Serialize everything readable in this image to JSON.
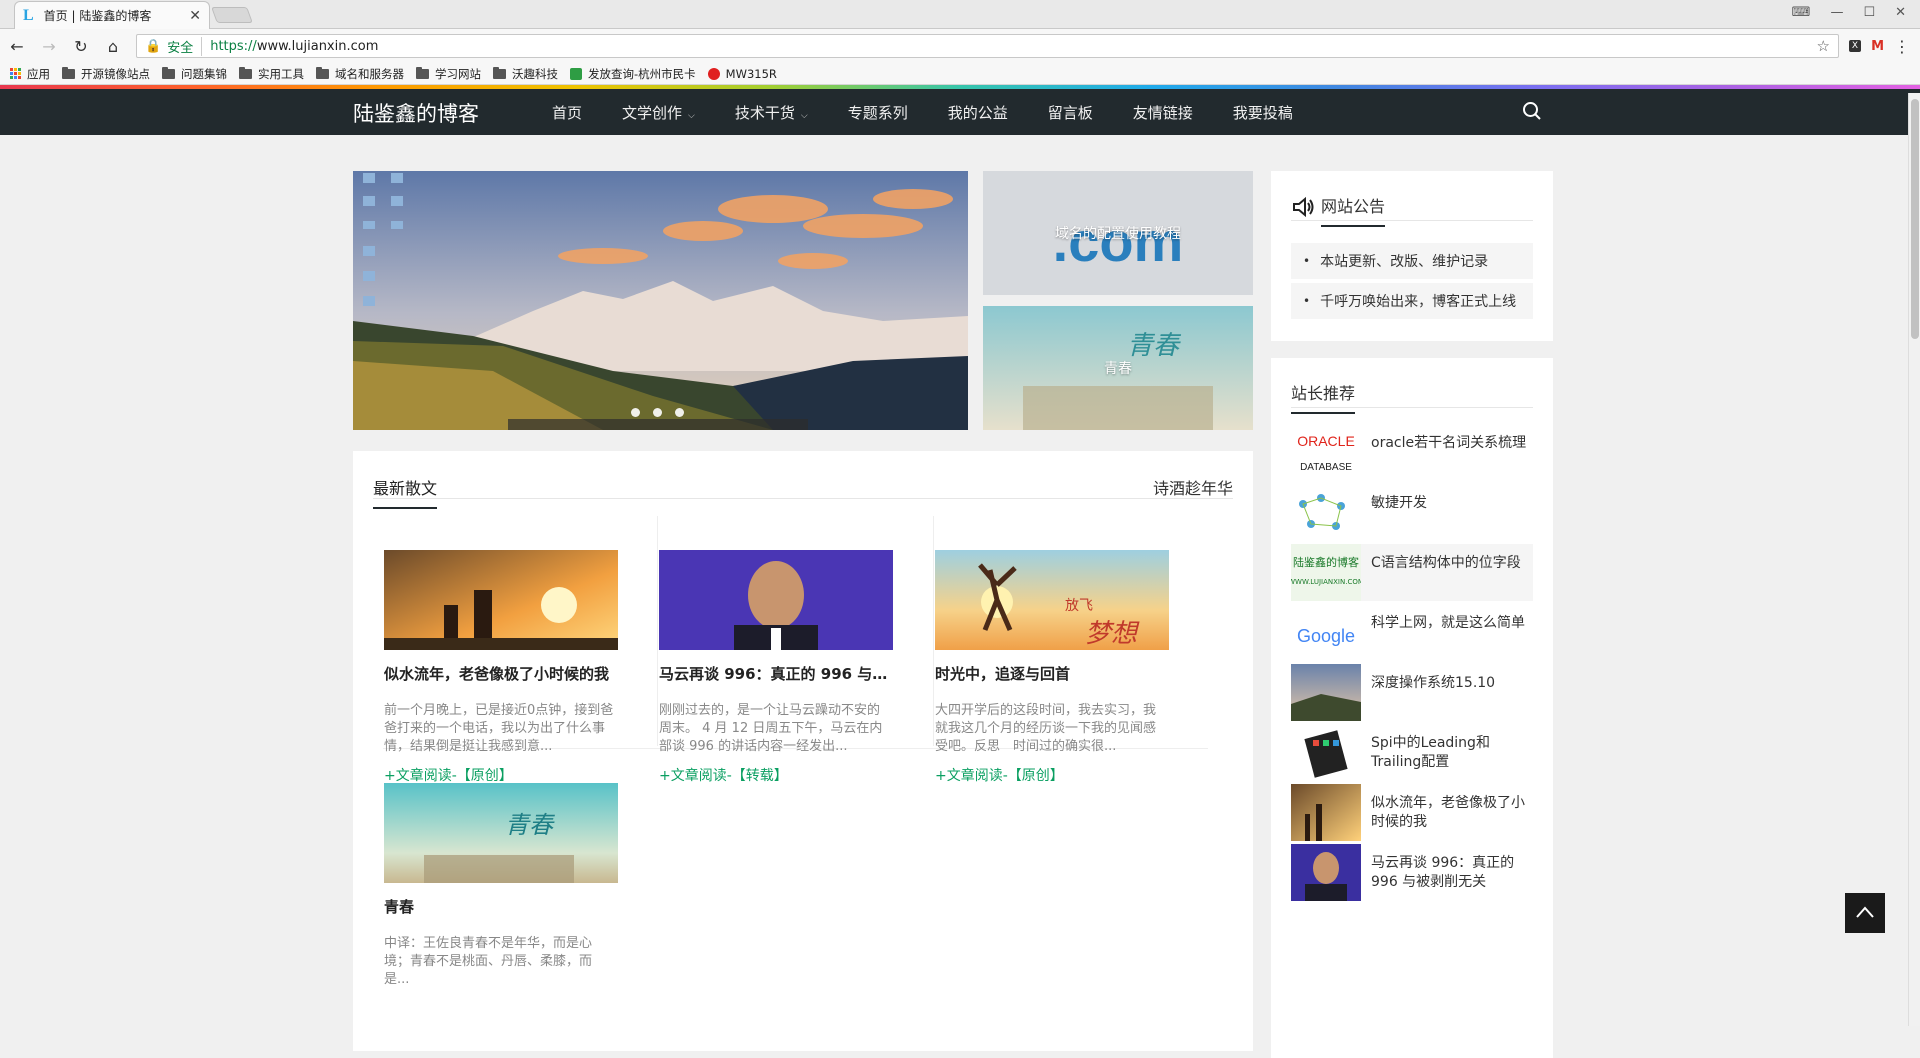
{
  "browser": {
    "tab_title": "首页 | 陆鉴鑫的博客",
    "tab_favicon": "L",
    "secure_label": "安全",
    "url_protocol": "https://",
    "url_rest": "www.lujianxin.com"
  },
  "bookmarks": [
    {
      "label": "应用",
      "icon": "apps-icon"
    },
    {
      "label": "开源镜像站点",
      "icon": "folder-icon"
    },
    {
      "label": "问题集锦",
      "icon": "folder-icon"
    },
    {
      "label": "实用工具",
      "icon": "folder-icon"
    },
    {
      "label": "域名和服务器",
      "icon": "folder-icon"
    },
    {
      "label": "学习网站",
      "icon": "folder-icon"
    },
    {
      "label": "沃趣科技",
      "icon": "folder-icon"
    },
    {
      "label": "发放查询-杭州市民卡",
      "icon": "green-app-icon"
    },
    {
      "label": "MW315R",
      "icon": "mercury-icon"
    }
  ],
  "site": {
    "brand": "陆鉴鑫的博客",
    "menu": [
      {
        "label": "首页",
        "dropdown": false
      },
      {
        "label": "文学创作",
        "dropdown": true
      },
      {
        "label": "技术干货",
        "dropdown": true
      },
      {
        "label": "专题系列",
        "dropdown": false
      },
      {
        "label": "我的公益",
        "dropdown": false
      },
      {
        "label": "留言板",
        "dropdown": false
      },
      {
        "label": "友情链接",
        "dropdown": false
      },
      {
        "label": "我要投稿",
        "dropdown": false
      }
    ]
  },
  "featured": {
    "card1_caption": "域名的配置使用教程",
    "card2_caption": "青春"
  },
  "panel": {
    "tab_active": "最新散文",
    "tab_right": "诗酒趁年华",
    "posts": [
      {
        "title": "似水流年，老爸像极了小时候的我",
        "excerpt": "前一个月晚上，已是接近0点钟，接到爸爸打来的一个电话，我以为出了什么事情，结果倒是挺让我感到意...",
        "more": "+文章阅读-【原创】"
      },
      {
        "title": "马云再谈 996：真正的 996 与被剥削无关",
        "excerpt": "刚刚过去的，是一个让马云躁动不安的周末。 4 月 12 日周五下午，马云在内部谈 996 的讲话内容一经发出...",
        "more": "+文章阅读-【转载】"
      },
      {
        "title": "时光中，追逐与回首",
        "excerpt": "大四开学后的这段时间，我去实习，我就我这几个月的经历谈一下我的见闻感受吧。反思　时间过的确实很...",
        "more": "+文章阅读-【原创】"
      },
      {
        "title": "青春",
        "excerpt": "中译：王佐良青春不是年华，而是心境；青春不是桃面、丹唇、柔膝，而是...",
        "more": ""
      }
    ]
  },
  "sidebar": {
    "notice_title": "网站公告",
    "notices": [
      "本站更新、改版、维护记录",
      "千呼万唤始出来，博客正式上线"
    ],
    "rec_title": "站长推荐",
    "recs": [
      {
        "title": "oracle若干名词关系梳理"
      },
      {
        "title": "敏捷开发"
      },
      {
        "title": "C语言结构体中的位字段"
      },
      {
        "title": "科学上网，就是这么简单"
      },
      {
        "title": "深度操作系统15.10"
      },
      {
        "title": "Spi中的Leading和Trailing配置"
      },
      {
        "title": "似水流年，老爸像极了小时候的我"
      },
      {
        "title": "马云再谈 996：真正的 996 与被剥削无关"
      }
    ],
    "oracle_top": "ORACLE",
    "oracle_bottom": "DATABASE",
    "site_thumb_text": "陆鉴鑫的博客",
    "site_thumb_url": "WWW.LUJIANXIN.COM",
    "google_text": "Google"
  },
  "thumb_texts": {
    "domain_words": ".com",
    "flyaway_small": "放飞",
    "flyaway_big": "梦想",
    "youth_big": "青春"
  },
  "colors": {
    "nav_bg": "#222a2e",
    "link_green": "#0a9f61",
    "secure_green": "#0b8043"
  }
}
